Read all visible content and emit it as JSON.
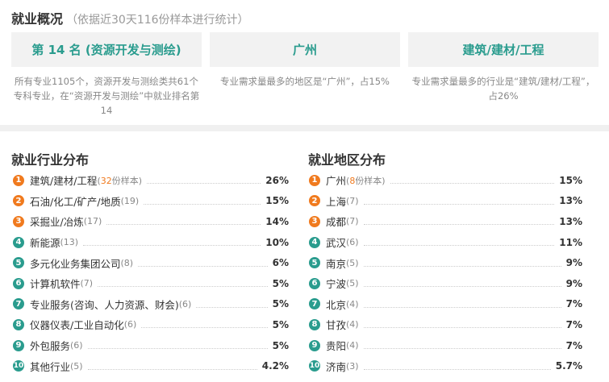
{
  "overview": {
    "title": "就业概况",
    "subtitle": "（依据近30天116份样本进行统计）",
    "cards": [
      {
        "headline": "第 14 名 (资源开发与测绘)",
        "desc": "所有专业1105个，资源开发与测绘类共61个专科专业，在“资源开发与测绘”中就业排名第14"
      },
      {
        "headline": "广州",
        "desc": "专业需求量最多的地区是“广州”，占15%"
      },
      {
        "headline": "建筑/建材/工程",
        "desc": "专业需求量最多的行业是“建筑/建材/工程”，占26%"
      }
    ]
  },
  "industry": {
    "title": "就业行业分布",
    "items": [
      {
        "rank": "1",
        "name": "建筑/建材/工程",
        "count_num": "32",
        "count_suffix": "份样本)",
        "count": "",
        "pct": "26%"
      },
      {
        "rank": "2",
        "name": "石油/化工/矿产/地质",
        "count": "(19)",
        "pct": "15%"
      },
      {
        "rank": "3",
        "name": "采掘业/冶炼",
        "count": "(17)",
        "pct": "14%"
      },
      {
        "rank": "4",
        "name": "新能源",
        "count": "(13)",
        "pct": "10%"
      },
      {
        "rank": "5",
        "name": "多元化业务集团公司",
        "count": "(8)",
        "pct": "6%"
      },
      {
        "rank": "6",
        "name": "计算机软件",
        "count": "(7)",
        "pct": "5%"
      },
      {
        "rank": "7",
        "name": "专业服务(咨询、人力资源、财会)",
        "count": "(6)",
        "pct": "5%"
      },
      {
        "rank": "8",
        "name": "仪器仪表/工业自动化",
        "count": "(6)",
        "pct": "5%"
      },
      {
        "rank": "9",
        "name": "外包服务",
        "count": "(6)",
        "pct": "5%"
      },
      {
        "rank": "10",
        "name": "其他行业",
        "count": "(5)",
        "pct": "4.2%"
      }
    ]
  },
  "region": {
    "title": "就业地区分布",
    "items": [
      {
        "rank": "1",
        "name": "广州",
        "count_num": "8",
        "count_suffix": "份样本)",
        "count": "",
        "pct": "15%"
      },
      {
        "rank": "2",
        "name": "上海",
        "count": "(7)",
        "pct": "13%"
      },
      {
        "rank": "3",
        "name": "成都",
        "count": "(7)",
        "pct": "13%"
      },
      {
        "rank": "4",
        "name": "武汉",
        "count": "(6)",
        "pct": "11%"
      },
      {
        "rank": "5",
        "name": "南京",
        "count": "(5)",
        "pct": "9%"
      },
      {
        "rank": "6",
        "name": "宁波",
        "count": "(5)",
        "pct": "9%"
      },
      {
        "rank": "7",
        "name": "北京",
        "count": "(4)",
        "pct": "7%"
      },
      {
        "rank": "8",
        "name": "甘孜",
        "count": "(4)",
        "pct": "7%"
      },
      {
        "rank": "9",
        "name": "贵阳",
        "count": "(4)",
        "pct": "7%"
      },
      {
        "rank": "10",
        "name": "济南",
        "count": "(3)",
        "pct": "5.7%"
      }
    ]
  },
  "colors": {
    "accent": "#2a9c8e",
    "hot": "#f07a1e"
  }
}
